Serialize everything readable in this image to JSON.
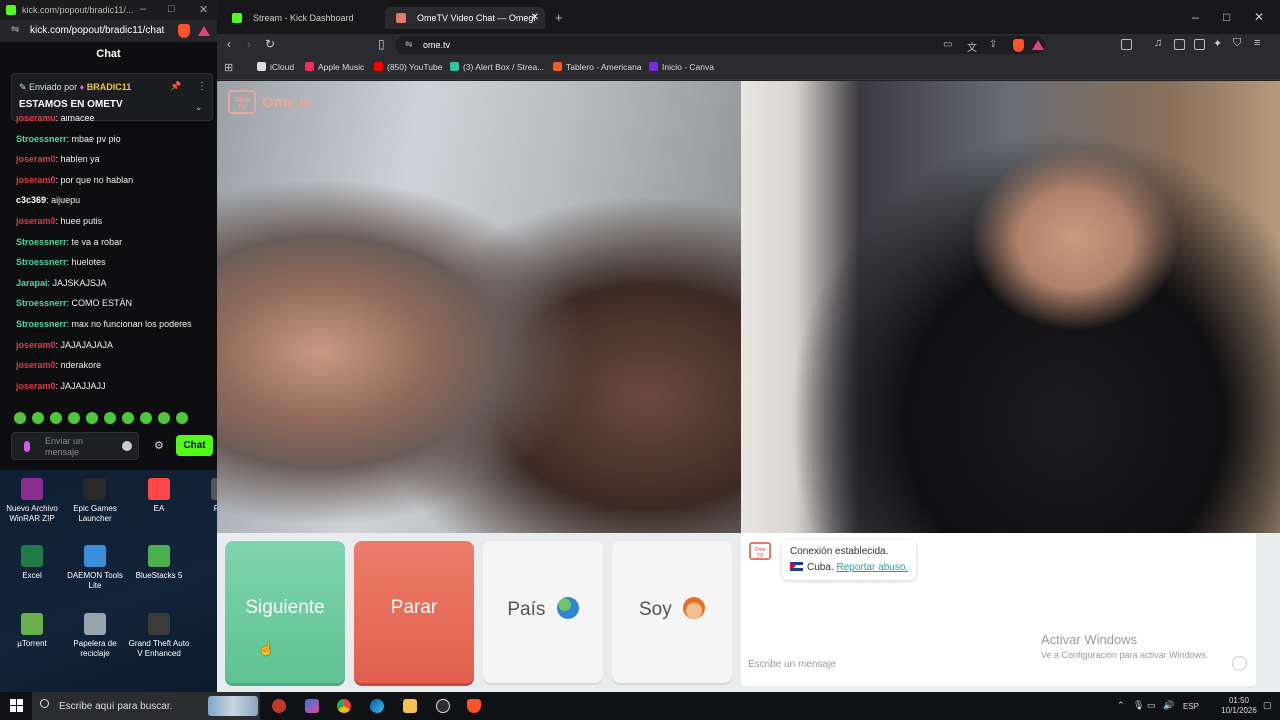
{
  "kick_window": {
    "title": "kick.com/popout/bradic11/...",
    "url": "kick.com/popout/bradic11/chat",
    "chat_header": "Chat",
    "pinned": {
      "label": "Enviado por",
      "sender": "BRADIC11",
      "message": "ESTAMOS EN OMETV"
    },
    "messages": [
      {
        "user": "joseram0",
        "text": "almacee",
        "color": "#e0394a"
      },
      {
        "user": "Stroessnerr",
        "text": "mbae pv pio",
        "color": "#4ed6a0"
      },
      {
        "user": "joseram0",
        "text": "hablen ya",
        "color": "#e0394a"
      },
      {
        "user": "joseram0",
        "text": "por que no hablan",
        "color": "#e0394a"
      },
      {
        "user": "c3c369",
        "text": "aijuepu",
        "color": "#ffffff"
      },
      {
        "user": "joseram0",
        "text": "huee putis",
        "color": "#e0394a"
      },
      {
        "user": "Stroessnerr",
        "text": "te va a robar",
        "color": "#4ed6a0"
      },
      {
        "user": "Stroessnerr",
        "text": "huelotes",
        "color": "#4ed6a0"
      },
      {
        "user": "Jarapai",
        "text": "JAJSKAJSJA",
        "color": "#4ed6a0"
      },
      {
        "user": "Stroessnerr",
        "text": "COMO ESTÁN",
        "color": "#4ed6a0"
      },
      {
        "user": "Stroessnerr",
        "text": "max no funcionan los poderes",
        "color": "#4ed6a0"
      },
      {
        "user": "joseram0",
        "text": "JAJAJAJAJA",
        "color": "#e0394a"
      },
      {
        "user": "joseram0",
        "text": "nderakore",
        "color": "#e0394a"
      },
      {
        "user": "joseram0",
        "text": "JAJAJJAJJ",
        "color": "#e0394a"
      }
    ],
    "input_placeholder": "Enviar un mensaje",
    "send_label": "Chat"
  },
  "desktop_icons": [
    {
      "label": "Nuevo Archivo WinRAR ZIP",
      "color": "#8b2e8f"
    },
    {
      "label": "Epic Games Launcher",
      "color": "#2a2a2a"
    },
    {
      "label": "EA",
      "color": "#ff4747"
    },
    {
      "label": "Robl",
      "color": "#555555"
    },
    {
      "label": "Excel",
      "color": "#1f7a45"
    },
    {
      "label": "DAEMON Tools Lite",
      "color": "#3b8fd9"
    },
    {
      "label": "BlueStacks 5",
      "color": "#4caf50"
    },
    {
      "label": "µTorrent",
      "color": "#6ab04c"
    },
    {
      "label": "Papelera de reciclaje",
      "color": "#9aa4ad"
    },
    {
      "label": "Grand Theft Auto V Enhanced",
      "color": "#3b3b3b"
    }
  ],
  "browser": {
    "tabs": [
      {
        "label": "Stream - Kick Dashboard",
        "active": false,
        "icon_color": "#53fc18"
      },
      {
        "label": "OmeTV Video Chat — Omegl",
        "active": true,
        "icon_color": "#e07a6b"
      }
    ],
    "url": "ome.tv",
    "bookmarks": [
      {
        "label": "iCloud",
        "color": "#dddddd"
      },
      {
        "label": "Apple Music",
        "color": "#fa2d55"
      },
      {
        "label": "(850) YouTube",
        "color": "#ff0000"
      },
      {
        "label": "(3) Alert Box / Strea...",
        "color": "#31c3a2"
      },
      {
        "label": "Tablero - Americana",
        "color": "#f15a24"
      },
      {
        "label": "Inicio - Canva",
        "color": "#7d2ae8"
      }
    ]
  },
  "ometv": {
    "brand": "Ome.tv",
    "logo_text": "Ome TV",
    "buttons": {
      "next": "Siguiente",
      "stop": "Parar",
      "country": "País",
      "gender": "Soy"
    },
    "status_line1": "Conexión establecida.",
    "status_country": "Cuba.",
    "report_link": "Reportar abuso.",
    "message_placeholder": "Escribe un mensaje",
    "activate_title": "Activar Windows",
    "activate_sub": "Ve a Configuración para activar Windows."
  },
  "taskbar": {
    "search_placeholder": "Escribe aquí para buscar.",
    "language": "ESP",
    "time": "01:50",
    "date": "10/1/2026"
  }
}
